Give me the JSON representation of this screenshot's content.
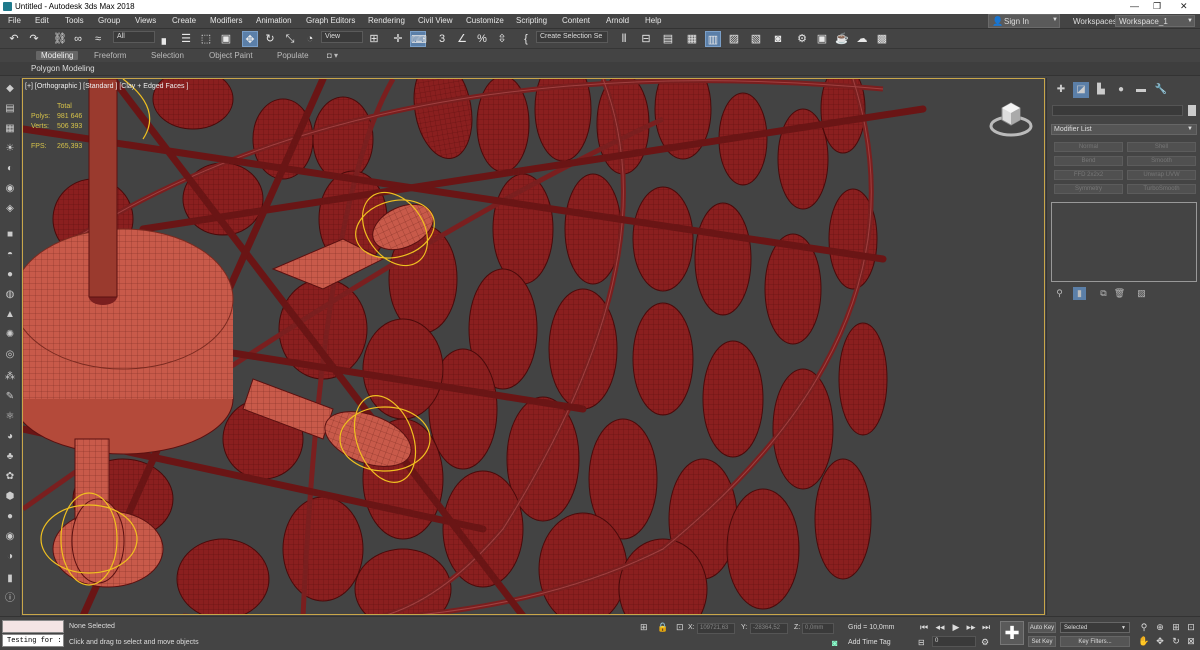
{
  "window": {
    "title": "Untitled - Autodesk 3ds Max 2018",
    "minimize": "—",
    "restore": "❐",
    "close": "✕"
  },
  "menu": [
    "File",
    "Edit",
    "Tools",
    "Group",
    "Views",
    "Create",
    "Modifiers",
    "Animation",
    "Graph Editors",
    "Rendering",
    "Civil View",
    "Customize",
    "Scripting",
    "Content",
    "Arnold",
    "Help"
  ],
  "account": {
    "signin": "Sign In",
    "workspaces_label": "Workspaces:",
    "workspace": "Workspace_1"
  },
  "toolbar": {
    "filter": "All",
    "refcoord": "View",
    "named_selection": "Create Selection Se"
  },
  "ribbon": {
    "tabs": [
      "Modeling",
      "Freeform",
      "Selection",
      "Object Paint",
      "Populate"
    ],
    "active": "Modeling",
    "subtitle": "Polygon Modeling"
  },
  "viewport": {
    "label": "[+] [Orthographic ] [Standard ] [Clay + Edged Faces ]",
    "stats": {
      "total_label": "Total",
      "polys_label": "Polys:",
      "polys": "981 646",
      "verts_label": "Verts:",
      "verts": "506 393",
      "fps_label": "FPS:",
      "fps": "265,393"
    }
  },
  "command_panel": {
    "modifier_list": "Modifier List",
    "modifier_buttons": [
      "Normal",
      "Shell",
      "Bend",
      "Smooth",
      "FFD 2x2x2",
      "Unwrap UVW",
      "Symmetry",
      "TurboSmooth"
    ]
  },
  "status": {
    "selection": "None Selected",
    "prompt": "Click and drag to select and move objects",
    "maxscript": "Testing for :",
    "x_label": "X:",
    "x": "109721,63",
    "y_label": "Y:",
    "y": "-28364,52",
    "z_label": "Z:",
    "z": "0,0mm",
    "grid": "Grid = 10,0mm",
    "add_time_tag": "Add Time Tag",
    "auto_key": "Auto Key",
    "set_key": "Set Key",
    "key_mode": "Selected",
    "key_filters": "Key Filters...",
    "frame": "0"
  },
  "colors": {
    "accent": "#5b7fa8",
    "viewport_border": "#c8a64a",
    "mesh": "#8a1f1f",
    "highlight": "#f0c020"
  }
}
